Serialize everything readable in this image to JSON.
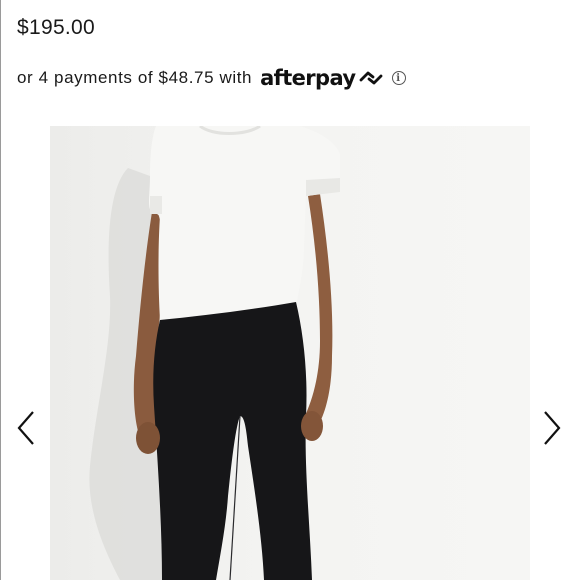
{
  "product": {
    "price": "$195.00"
  },
  "installments": {
    "text": "or 4 payments of $48.75 with",
    "provider": "afterpay",
    "provider_icon": "afterpay-arrows-icon",
    "info_icon": "info-icon"
  },
  "gallery": {
    "image_subject": "model wearing white short-sleeve tee and black leggings",
    "prev_icon": "chevron-left-icon",
    "next_icon": "chevron-right-icon"
  }
}
